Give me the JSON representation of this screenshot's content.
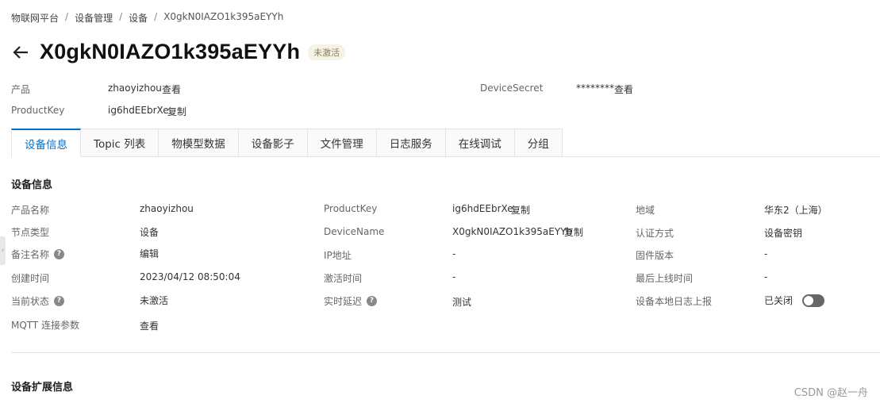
{
  "breadcrumb": [
    "物联网平台",
    "设备管理",
    "设备",
    "X0gkN0IAZO1k395aEYYh"
  ],
  "header": {
    "title": "X0gkN0IAZO1k395aEYYh",
    "status": "未激活"
  },
  "meta": {
    "product_label": "产品",
    "product_value": "zhaoyizhou",
    "product_link": "查看",
    "productkey_label": "ProductKey",
    "productkey_value": "ig6hdEEbrXe",
    "productkey_link": "复制",
    "secret_label": "DeviceSecret",
    "secret_value": "********",
    "secret_link": "查看"
  },
  "tabs": [
    {
      "label": "设备信息",
      "active": true
    },
    {
      "label": "Topic 列表",
      "active": false
    },
    {
      "label": "物模型数据",
      "active": false
    },
    {
      "label": "设备影子",
      "active": false
    },
    {
      "label": "文件管理",
      "active": false
    },
    {
      "label": "日志服务",
      "active": false
    },
    {
      "label": "在线调试",
      "active": false
    },
    {
      "label": "分组",
      "active": false
    }
  ],
  "section": {
    "info_title": "设备信息",
    "ext_title": "设备扩展信息"
  },
  "info": {
    "product_name_label": "产品名称",
    "product_name": "zhaoyizhou",
    "node_type_label": "节点类型",
    "node_type": "设备",
    "remark_label": "备注名称",
    "remark_link": "编辑",
    "created_label": "创建时间",
    "created": "2023/04/12 08:50:04",
    "state_label": "当前状态",
    "state": "未激活",
    "mqtt_label": "MQTT 连接参数",
    "mqtt_link": "查看",
    "pk_label": "ProductKey",
    "pk": "ig6hdEEbrXe",
    "pk_link": "复制",
    "dn_label": "DeviceName",
    "dn": "X0gkN0IAZO1k395aEYYh",
    "dn_link": "复制",
    "ip_label": "IP地址",
    "ip": "-",
    "activated_label": "激活时间",
    "activated": "-",
    "latency_label": "实时延迟",
    "latency_link": "测试",
    "region_label": "地域",
    "region": "华东2（上海）",
    "auth_label": "认证方式",
    "auth": "设备密钥",
    "firmware_label": "固件版本",
    "firmware": "-",
    "last_online_label": "最后上线时间",
    "last_online": "-",
    "log_label": "设备本地日志上报",
    "log_state": "已关闭",
    "log_enabled": false
  },
  "watermark": "CSDN @赵一舟"
}
